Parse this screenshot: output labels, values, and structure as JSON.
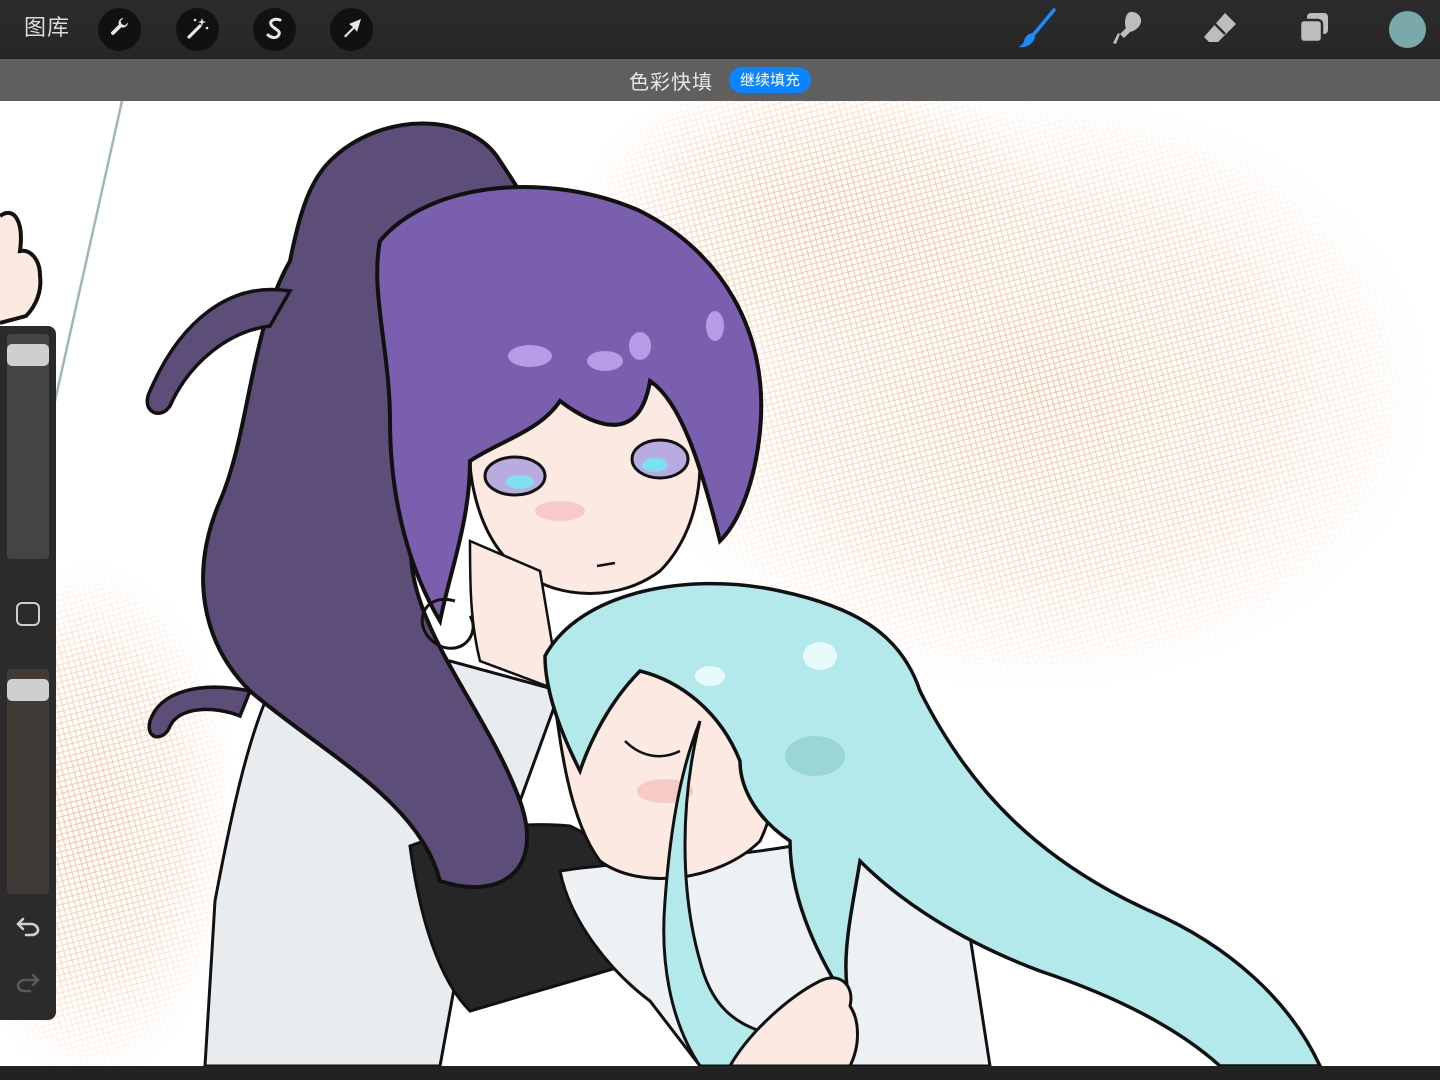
{
  "toolbar": {
    "gallery_label": "图库",
    "left_tools": [
      {
        "name": "actions",
        "icon": "wrench-icon"
      },
      {
        "name": "adjustments",
        "icon": "magic-wand-icon"
      },
      {
        "name": "selection",
        "icon": "selection-s-icon"
      },
      {
        "name": "transform",
        "icon": "arrow-cursor-icon"
      }
    ],
    "right_tools": [
      {
        "name": "brush",
        "icon": "brush-icon",
        "active": true
      },
      {
        "name": "smudge",
        "icon": "smudge-icon",
        "active": false
      },
      {
        "name": "eraser",
        "icon": "eraser-icon",
        "active": false
      },
      {
        "name": "layers",
        "icon": "layers-icon",
        "active": false
      }
    ],
    "current_color": "#7aa9ab"
  },
  "banner": {
    "title": "色彩快填",
    "action_label": "继续填充"
  },
  "sidebar": {
    "brush_size_level": 0.95,
    "brush_opacity_level": 0.95,
    "icons": [
      "modifier-square-icon",
      "undo-icon",
      "redo-icon"
    ]
  },
  "colors": {
    "accent": "#0a84ff",
    "active_tool": "#1a8cff",
    "purple_hair": "#7a5fae",
    "purple_hair_shadow": "#5c4e78",
    "teal_hair": "#b3e9ea",
    "skin": "#fbe9e2",
    "halftone": "#f2a870"
  }
}
